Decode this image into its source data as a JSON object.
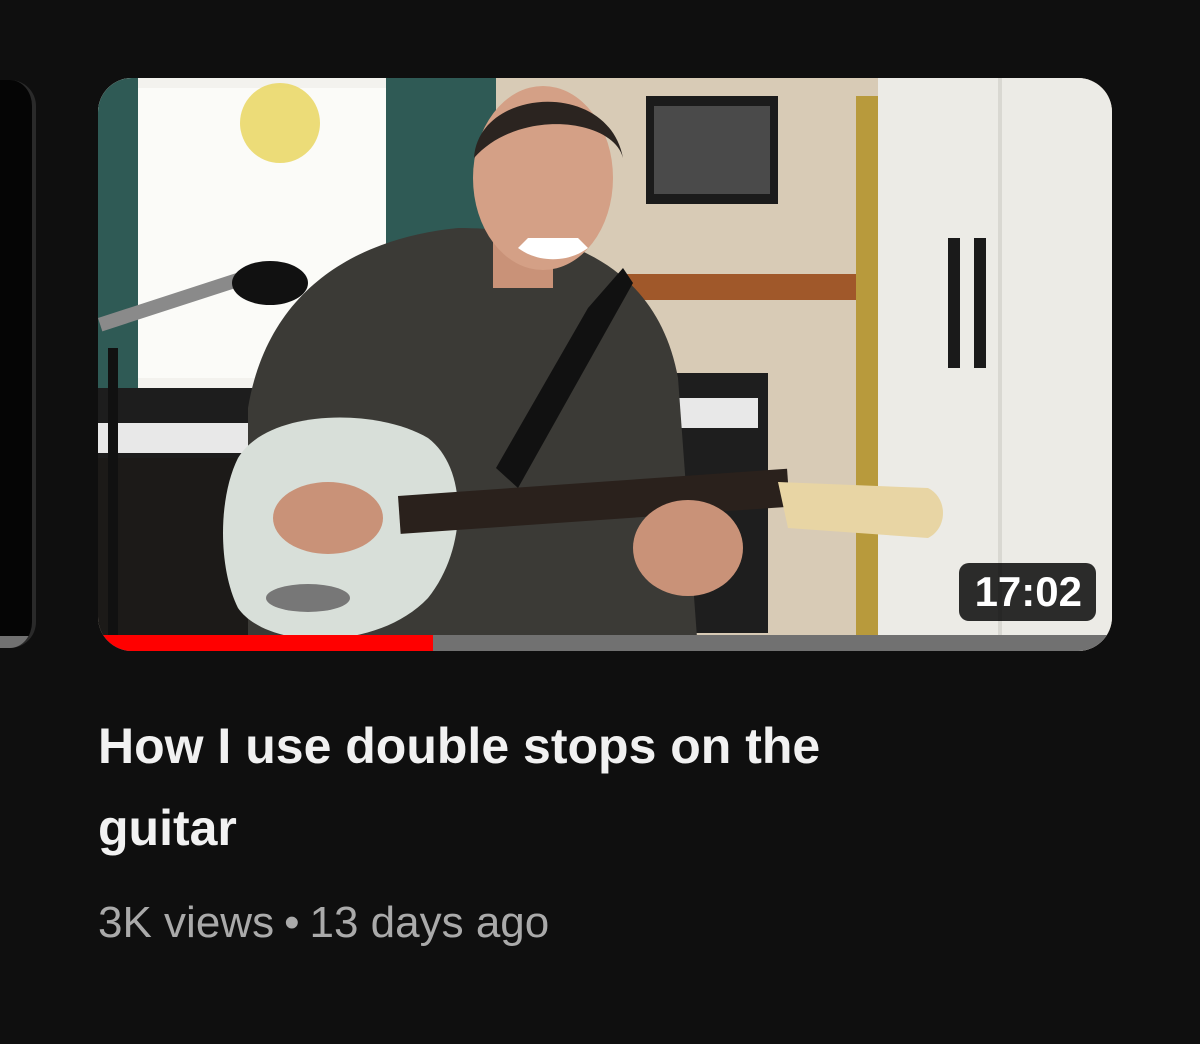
{
  "video": {
    "title": "How I use double stops on the guitar",
    "duration": "17:02",
    "views": "3K views",
    "separator": "•",
    "age": "13 days ago",
    "watch_progress": 0.33,
    "thumbnail_alt": "guitar-lesson-thumbnail"
  },
  "colors": {
    "background": "#0f0f0f",
    "progress": "#ff0000",
    "progress_track": "#717171",
    "title": "#f1f1f1",
    "meta": "#aaaaaa"
  }
}
